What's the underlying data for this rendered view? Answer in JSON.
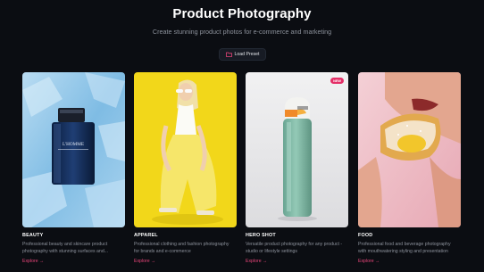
{
  "header": {
    "title": "Product Photography",
    "subtitle": "Create stunning product photos for e-commerce and marketing"
  },
  "toolbar": {
    "load_preset_label": "Load Preset",
    "load_preset_icon": "folder-icon"
  },
  "accent_color": "#e8457a",
  "cards": [
    {
      "category": "BEAUTY",
      "description": "Professional beauty and skincare product photography with stunning surfaces and...",
      "explore_label": "Explore",
      "bottle_text": "L'HOMME"
    },
    {
      "category": "APPAREL",
      "description": "Professional clothing and fashion photography for brands and e-commerce",
      "explore_label": "Explore"
    },
    {
      "category": "HERO SHOT",
      "description": "Versatile product photography for any product - studio or lifestyle settings",
      "explore_label": "Explore",
      "badge": "NEW"
    },
    {
      "category": "FOOD",
      "description": "Professional food and beverage photography with mouthwatering styling and presentation",
      "explore_label": "Explore"
    }
  ]
}
